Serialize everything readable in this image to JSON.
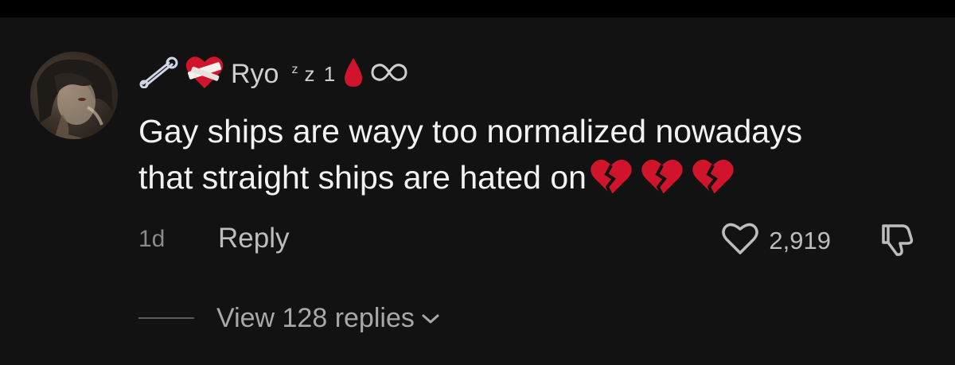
{
  "comment": {
    "username": "Ryo",
    "name_suffix": "z 1",
    "name_suffix_small": "z",
    "text_line1": "Gay ships are wayy too normalized nowadays",
    "text_line2": "that straight ships are hated on",
    "emojis": [
      "broken-heart-icon",
      "broken-heart-icon",
      "broken-heart-icon"
    ],
    "time": "1d",
    "reply_label": "Reply",
    "like_count": "2,919",
    "view_replies_label": "View 128 replies"
  },
  "colors": {
    "background": "#121212",
    "primary_text": "#f2f2f2",
    "secondary_text": "#bdbdbd",
    "muted_text": "#8a8a8a",
    "heart_red": "#d0142c"
  }
}
